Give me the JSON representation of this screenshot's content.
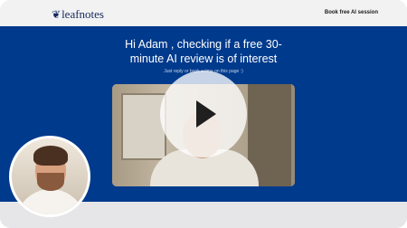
{
  "header": {
    "logo_text": "leafnotes",
    "logo_icon": "leaf-icon",
    "cta_label": "Book free AI session"
  },
  "hero": {
    "headline": "Hi Adam , checking if a free 30-minute AI review is of interest",
    "subtext": "Just reply or book a time on this page :)"
  },
  "video": {
    "play_icon": "play-icon"
  },
  "colors": {
    "hero_bg": "#003a8c",
    "brand_text": "#14295b"
  }
}
